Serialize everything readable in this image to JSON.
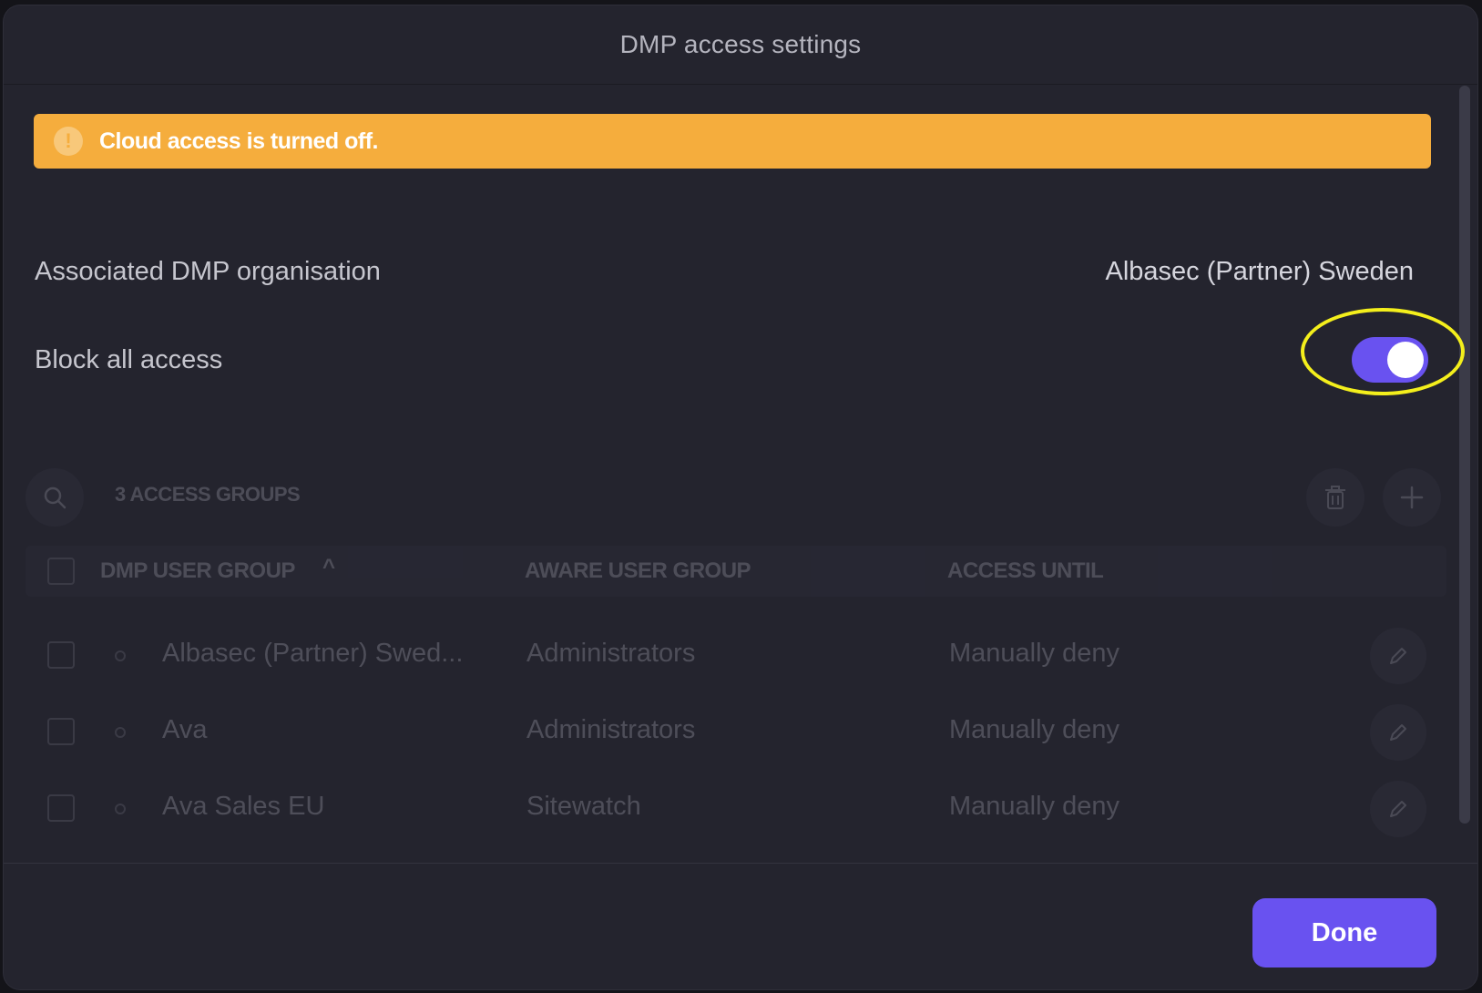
{
  "modal": {
    "title": "DMP access settings"
  },
  "alert": {
    "text": "Cloud access is turned off.",
    "color": "#f5ad3d"
  },
  "settings": {
    "org_label": "Associated DMP organisation",
    "org_value": "Albasec (Partner) Sweden",
    "block_label": "Block all access",
    "block_enabled": true
  },
  "access_groups": {
    "count_label": "3 ACCESS GROUPS",
    "columns": [
      "DMP USER GROUP",
      "AWARE USER GROUP",
      "ACCESS UNTIL"
    ],
    "sort_indicator": "^",
    "rows": [
      {
        "dmp_group": "Albasec (Partner) Swed...",
        "aware_group": "Administrators",
        "access_until": "Manually deny"
      },
      {
        "dmp_group": "Ava",
        "aware_group": "Administrators",
        "access_until": "Manually deny"
      },
      {
        "dmp_group": "Ava Sales EU",
        "aware_group": "Sitewatch",
        "access_until": "Manually deny"
      }
    ]
  },
  "footer": {
    "done_label": "Done"
  },
  "icons": {
    "search": "search-icon",
    "delete": "trash-icon",
    "add": "plus-icon",
    "edit": "pencil-icon",
    "alert": "exclamation-icon"
  },
  "colors": {
    "accent": "#6952f0",
    "background": "#24242e",
    "highlight": "#f4ef1c"
  }
}
